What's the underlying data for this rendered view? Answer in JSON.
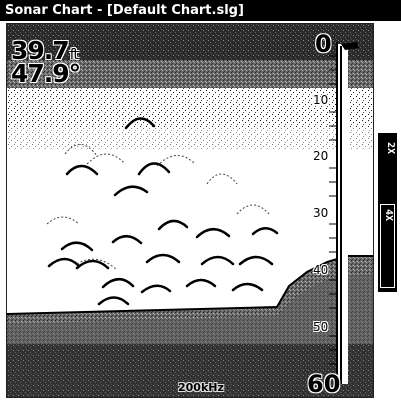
{
  "window": {
    "title": "Sonar Chart - [Default Chart.slg]"
  },
  "readouts": {
    "depth_value": "39.7",
    "depth_unit": "ft",
    "temperature": "47.9°"
  },
  "depth_scale": {
    "top": "0",
    "bottom": "60",
    "ticks": [
      "10",
      "20",
      "30",
      "40",
      "50"
    ]
  },
  "frequency": "200kHz",
  "zoom": {
    "options": [
      "2X",
      "4X"
    ],
    "selected": "4X"
  },
  "colors": {
    "background": "#ffffff",
    "title_bar": "#000000",
    "bottom_signal": "#555555"
  }
}
